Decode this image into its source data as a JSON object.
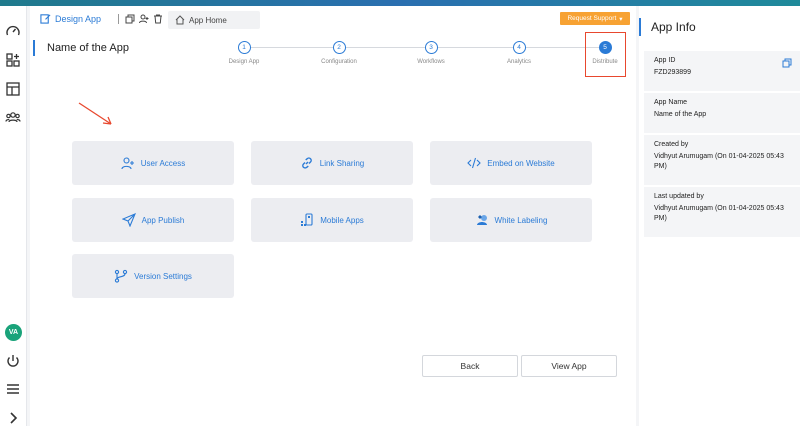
{
  "colors": {
    "accent": "#2b7bd6",
    "warning": "#f7a233",
    "highlight": "#e8482e",
    "avatar": "#1aa37a"
  },
  "rail": {
    "icons": [
      "speedometer-icon",
      "apps-add-icon",
      "layout-icon",
      "users-icon"
    ],
    "avatar_initials": "VA",
    "bottom_icons": [
      "power-icon",
      "menu-icon",
      "chevron-right-icon"
    ]
  },
  "header": {
    "design_app_label": "Design App",
    "app_home_label": "App Home",
    "request_support_label": "Request Support"
  },
  "page": {
    "title": "Name of the App"
  },
  "stepper": {
    "steps": [
      {
        "number": "1",
        "label": "Design App"
      },
      {
        "number": "2",
        "label": "Configuration"
      },
      {
        "number": "3",
        "label": "Workflows"
      },
      {
        "number": "4",
        "label": "Analytics"
      },
      {
        "number": "5",
        "label": "Distribute"
      }
    ],
    "active": 5
  },
  "tiles": [
    {
      "label": "User Access",
      "icon": "user-add-icon"
    },
    {
      "label": "Link Sharing",
      "icon": "link-icon"
    },
    {
      "label": "Embed on Website",
      "icon": "code-icon"
    },
    {
      "label": "App Publish",
      "icon": "send-icon"
    },
    {
      "label": "Mobile Apps",
      "icon": "mobile-apps-icon"
    },
    {
      "label": "White Labeling",
      "icon": "white-label-icon"
    },
    {
      "label": "Version Settings",
      "icon": "branch-icon"
    }
  ],
  "actions": {
    "back_label": "Back",
    "view_app_label": "View App"
  },
  "app_info": {
    "title": "App Info",
    "fields": [
      {
        "key": "App ID",
        "value": "FZD293899"
      },
      {
        "key": "App Name",
        "value": "Name of the App"
      },
      {
        "key": "Created by",
        "value": "Vidhyut Arumugam (On 01-04-2025 05:43 PM)"
      },
      {
        "key": "Last updated by",
        "value": "Vidhyut Arumugam (On 01-04-2025 05:43 PM)"
      }
    ]
  }
}
